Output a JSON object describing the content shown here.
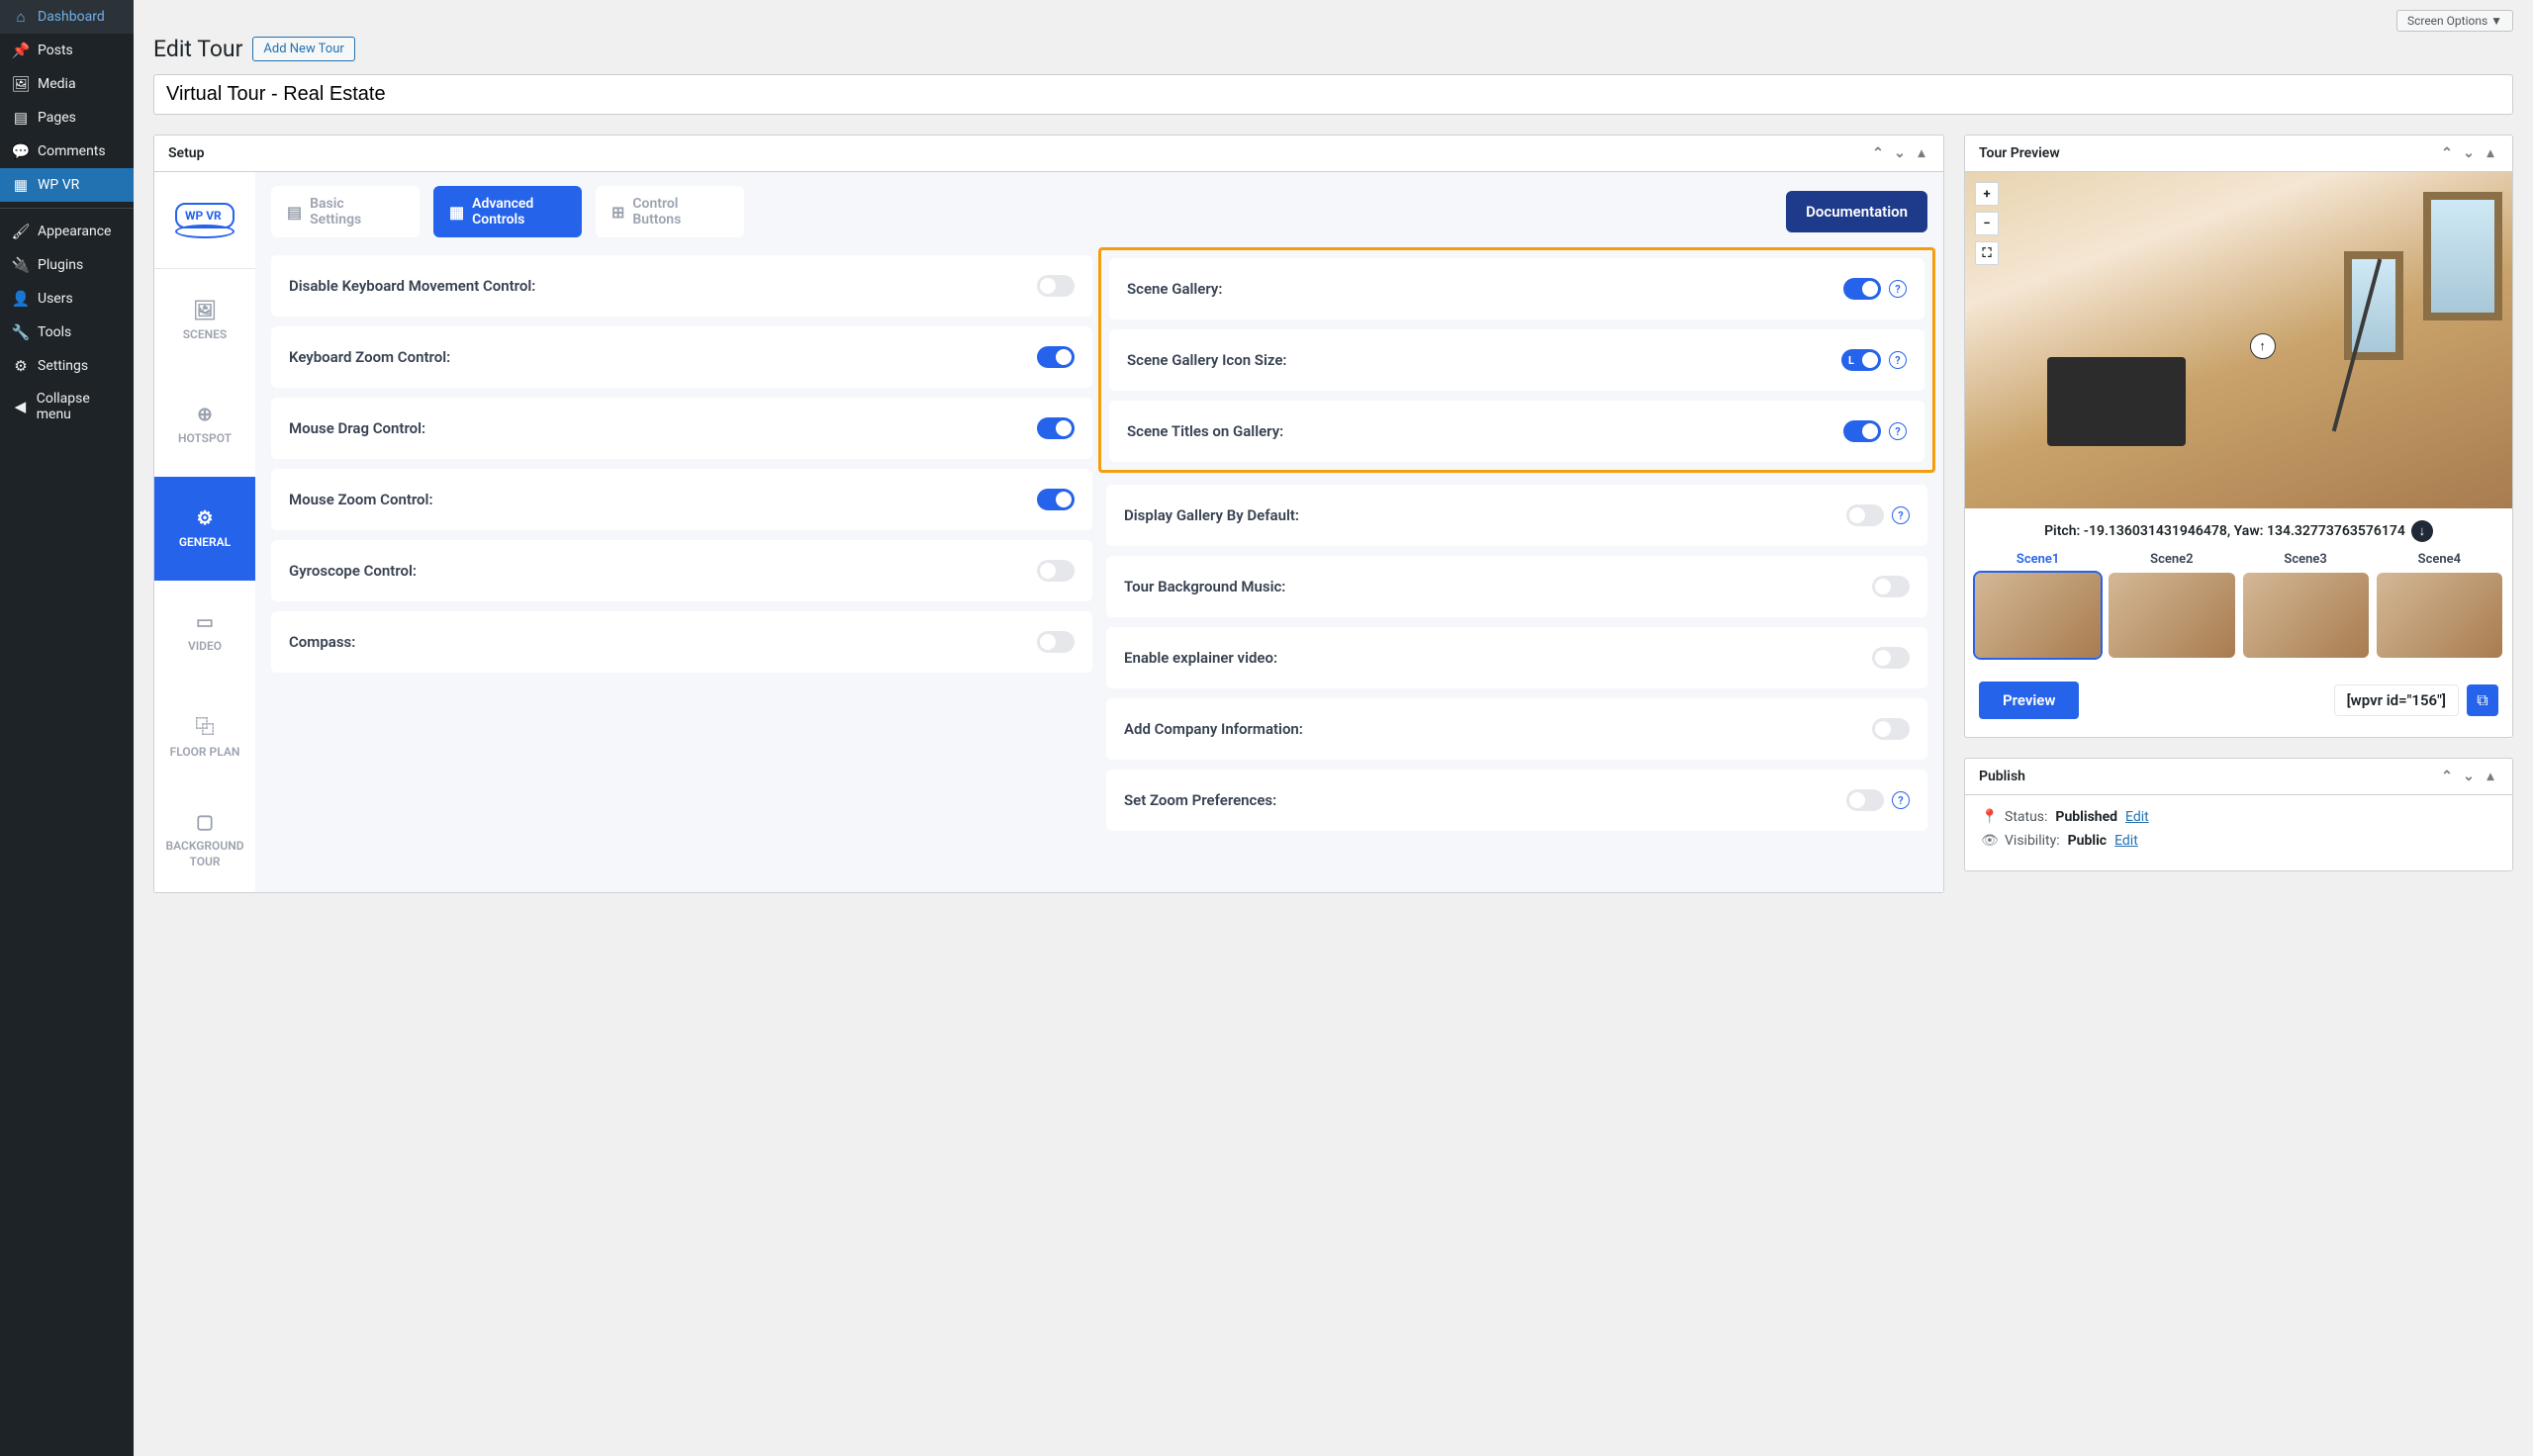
{
  "screen_options": "Screen Options ▼",
  "page_title": "Edit Tour",
  "add_new_button": "Add New Tour",
  "tour_title": "Virtual Tour - Real Estate",
  "sidebar_menu": [
    {
      "label": "Dashboard",
      "icon": "⌂"
    },
    {
      "label": "Posts",
      "icon": "📌"
    },
    {
      "label": "Media",
      "icon": "🖼"
    },
    {
      "label": "Pages",
      "icon": "▤"
    },
    {
      "label": "Comments",
      "icon": "💬"
    },
    {
      "label": "WP VR",
      "icon": "▦",
      "active": true
    },
    {
      "sep": true
    },
    {
      "label": "Appearance",
      "icon": "🖌"
    },
    {
      "label": "Plugins",
      "icon": "🔌"
    },
    {
      "label": "Users",
      "icon": "👤"
    },
    {
      "label": "Tools",
      "icon": "🔧"
    },
    {
      "label": "Settings",
      "icon": "⚙"
    },
    {
      "label": "Collapse menu",
      "icon": "◀"
    }
  ],
  "setup_box_title": "Setup",
  "setup_logo": "WP VR",
  "side_tabs": [
    {
      "label": "SCENES",
      "icon": "🖼"
    },
    {
      "label": "HOTSPOT",
      "icon": "⊕"
    },
    {
      "label": "GENERAL",
      "icon": "⚙",
      "active": true
    },
    {
      "label": "VIDEO",
      "icon": "▭"
    },
    {
      "label": "FLOOR PLAN",
      "icon": "⿻"
    },
    {
      "label": "BACKGROUND TOUR",
      "icon": "▢"
    }
  ],
  "top_tabs": {
    "basic": {
      "line1": "Basic",
      "line2": "Settings"
    },
    "advanced": {
      "line1": "Advanced",
      "line2": "Controls"
    },
    "control": {
      "line1": "Control",
      "line2": "Buttons"
    },
    "doc": "Documentation"
  },
  "left_settings": [
    {
      "label": "Disable Keyboard Movement Control:",
      "on": false
    },
    {
      "label": "Keyboard Zoom Control:",
      "on": true
    },
    {
      "label": "Mouse Drag Control:",
      "on": true
    },
    {
      "label": "Mouse Zoom Control:",
      "on": true
    },
    {
      "label": "Gyroscope Control:",
      "on": false
    },
    {
      "label": "Compass:",
      "on": false
    }
  ],
  "right_settings": {
    "highlighted": [
      {
        "label": "Scene Gallery:",
        "on": true,
        "help": true
      },
      {
        "label": "Scene Gallery Icon Size:",
        "size": "L",
        "help": true
      },
      {
        "label": "Scene Titles on Gallery:",
        "on": true,
        "help": true
      }
    ],
    "rest": [
      {
        "label": "Display Gallery By Default:",
        "on": false,
        "help": true
      },
      {
        "label": "Tour Background Music:",
        "on": false
      },
      {
        "label": "Enable explainer video:",
        "on": false
      },
      {
        "label": "Add Company Information:",
        "on": false
      },
      {
        "label": "Set Zoom Preferences:",
        "on": false,
        "help": true
      }
    ]
  },
  "preview": {
    "box_title": "Tour Preview",
    "zoom_in": "+",
    "zoom_out": "−",
    "pitch_yaw": "Pitch: -19.136031431946478, Yaw: 134.32773763576174",
    "download_icon": "↓",
    "arrow_icon": "↑",
    "scenes": [
      "Scene1",
      "Scene2",
      "Scene3",
      "Scene4"
    ],
    "preview_btn": "Preview",
    "shortcode": "[wpvr id=\"156\"]"
  },
  "publish": {
    "box_title": "Publish",
    "status_label": "Status:",
    "status_value": "Published",
    "visibility_label": "Visibility:",
    "visibility_value": "Public",
    "edit": "Edit"
  }
}
